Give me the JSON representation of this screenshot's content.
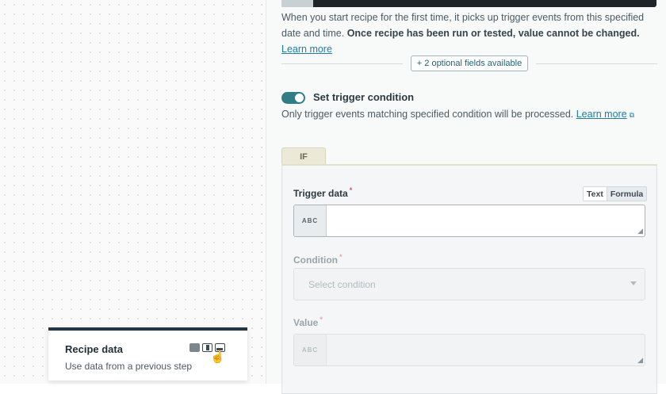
{
  "trigger_from": {
    "hint_start": "When you start recipe for the first time, it picks up trigger events from this specified date and time.",
    "hint_bold": "Once recipe has been run or tested, value cannot be changed.",
    "learn_more": "Learn more"
  },
  "optional_fields": {
    "label": "+ 2 optional fields available"
  },
  "trigger_condition": {
    "toggle_on": true,
    "label": "Set trigger condition",
    "hint": "Only trigger events matching specified condition will be processed.",
    "learn_more": "Learn more"
  },
  "if_block": {
    "tab_label": "IF",
    "trigger_data": {
      "label": "Trigger data",
      "required": "*",
      "type_badge": "ABC",
      "mode_text": "Text",
      "mode_formula": "Formula",
      "value": ""
    },
    "condition": {
      "label": "Condition",
      "required": "*",
      "placeholder": "Select condition"
    },
    "value": {
      "label": "Value",
      "required": "*",
      "type_badge": "ABC"
    }
  },
  "recipe_data_card": {
    "title": "Recipe data",
    "subtitle": "Use data from a previous step"
  },
  "colors": {
    "accent_teal": "#2f7e86",
    "link": "#1a7fa6",
    "card_border": "#1f3844"
  }
}
